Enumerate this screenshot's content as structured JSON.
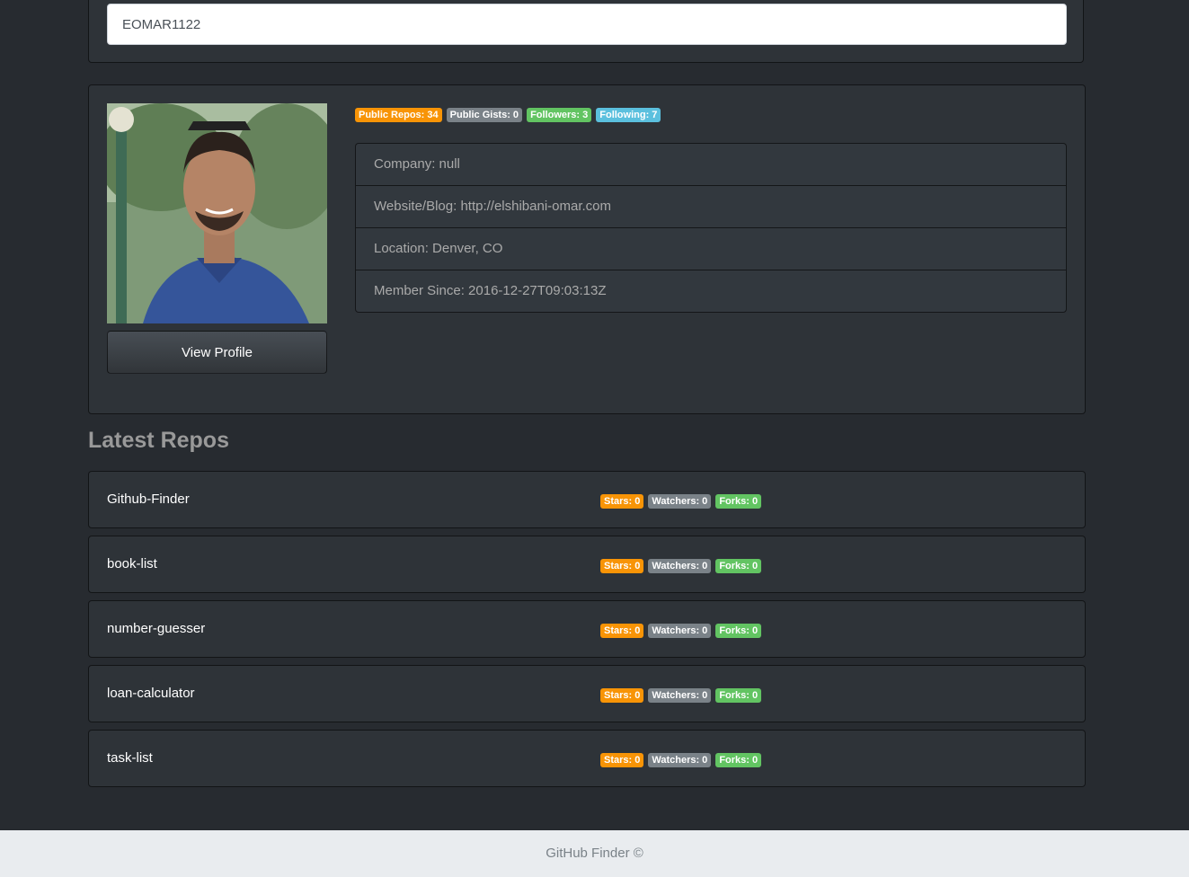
{
  "search": {
    "value": "EOMAR1122"
  },
  "profile": {
    "avatar_alt": "avatar",
    "view_profile_label": "View Profile",
    "badges": {
      "public_repos": "Public Repos: 34",
      "public_gists": "Public Gists: 0",
      "followers": "Followers: 3",
      "following": "Following: 7"
    },
    "info": {
      "company": "Company: null",
      "website": "Website/Blog: http://elshibani-omar.com",
      "location": "Location: Denver, CO",
      "member_since": "Member Since: 2016-12-27T09:03:13Z"
    }
  },
  "repos": {
    "title": "Latest Repos",
    "items": [
      {
        "name": "Github-Finder",
        "stars": "Stars: 0",
        "watchers": "Watchers: 0",
        "forks": "Forks: 0"
      },
      {
        "name": "book-list",
        "stars": "Stars: 0",
        "watchers": "Watchers: 0",
        "forks": "Forks: 0"
      },
      {
        "name": "number-guesser",
        "stars": "Stars: 0",
        "watchers": "Watchers: 0",
        "forks": "Forks: 0"
      },
      {
        "name": "loan-calculator",
        "stars": "Stars: 0",
        "watchers": "Watchers: 0",
        "forks": "Forks: 0"
      },
      {
        "name": "task-list",
        "stars": "Stars: 0",
        "watchers": "Watchers: 0",
        "forks": "Forks: 0"
      }
    ]
  },
  "footer": {
    "text": "GitHub Finder ©"
  },
  "colors": {
    "background": "#272b30",
    "card": "#2e3338",
    "badge_orange": "#f89406",
    "badge_gray": "#7a8288",
    "badge_green": "#62c462",
    "badge_blue": "#5bc0de",
    "footer_bg": "#e9ecef"
  }
}
